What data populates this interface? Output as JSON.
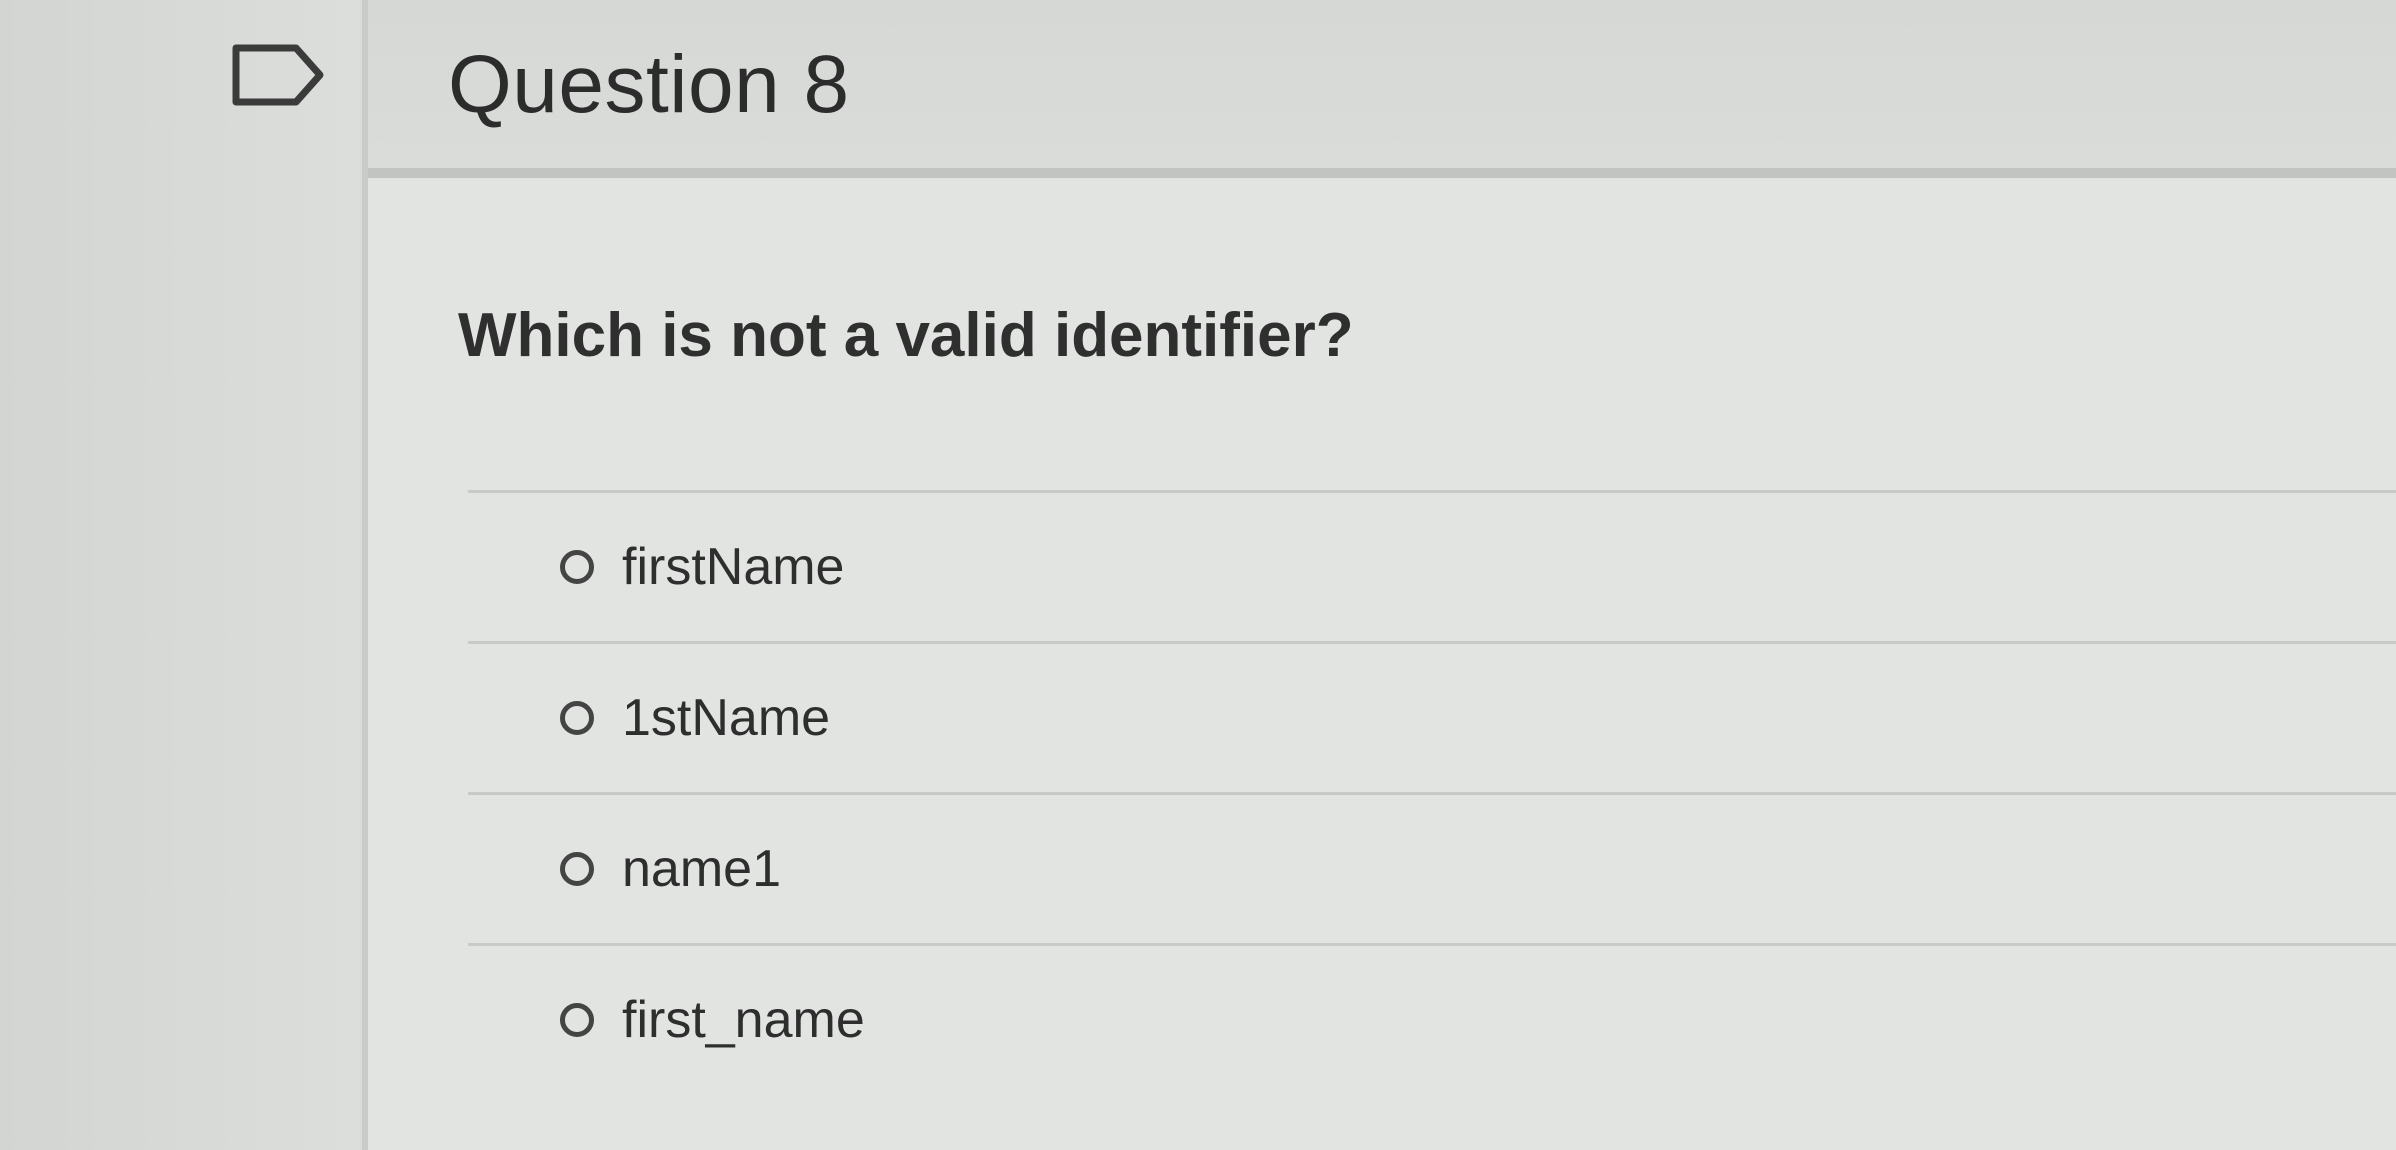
{
  "question": {
    "title": "Question 8",
    "text": "Which is not a valid identifier?",
    "flag_icon": "flag-icon"
  },
  "answers": [
    {
      "label": "firstName"
    },
    {
      "label": "1stName"
    },
    {
      "label": "name1"
    },
    {
      "label": "first_name"
    }
  ]
}
